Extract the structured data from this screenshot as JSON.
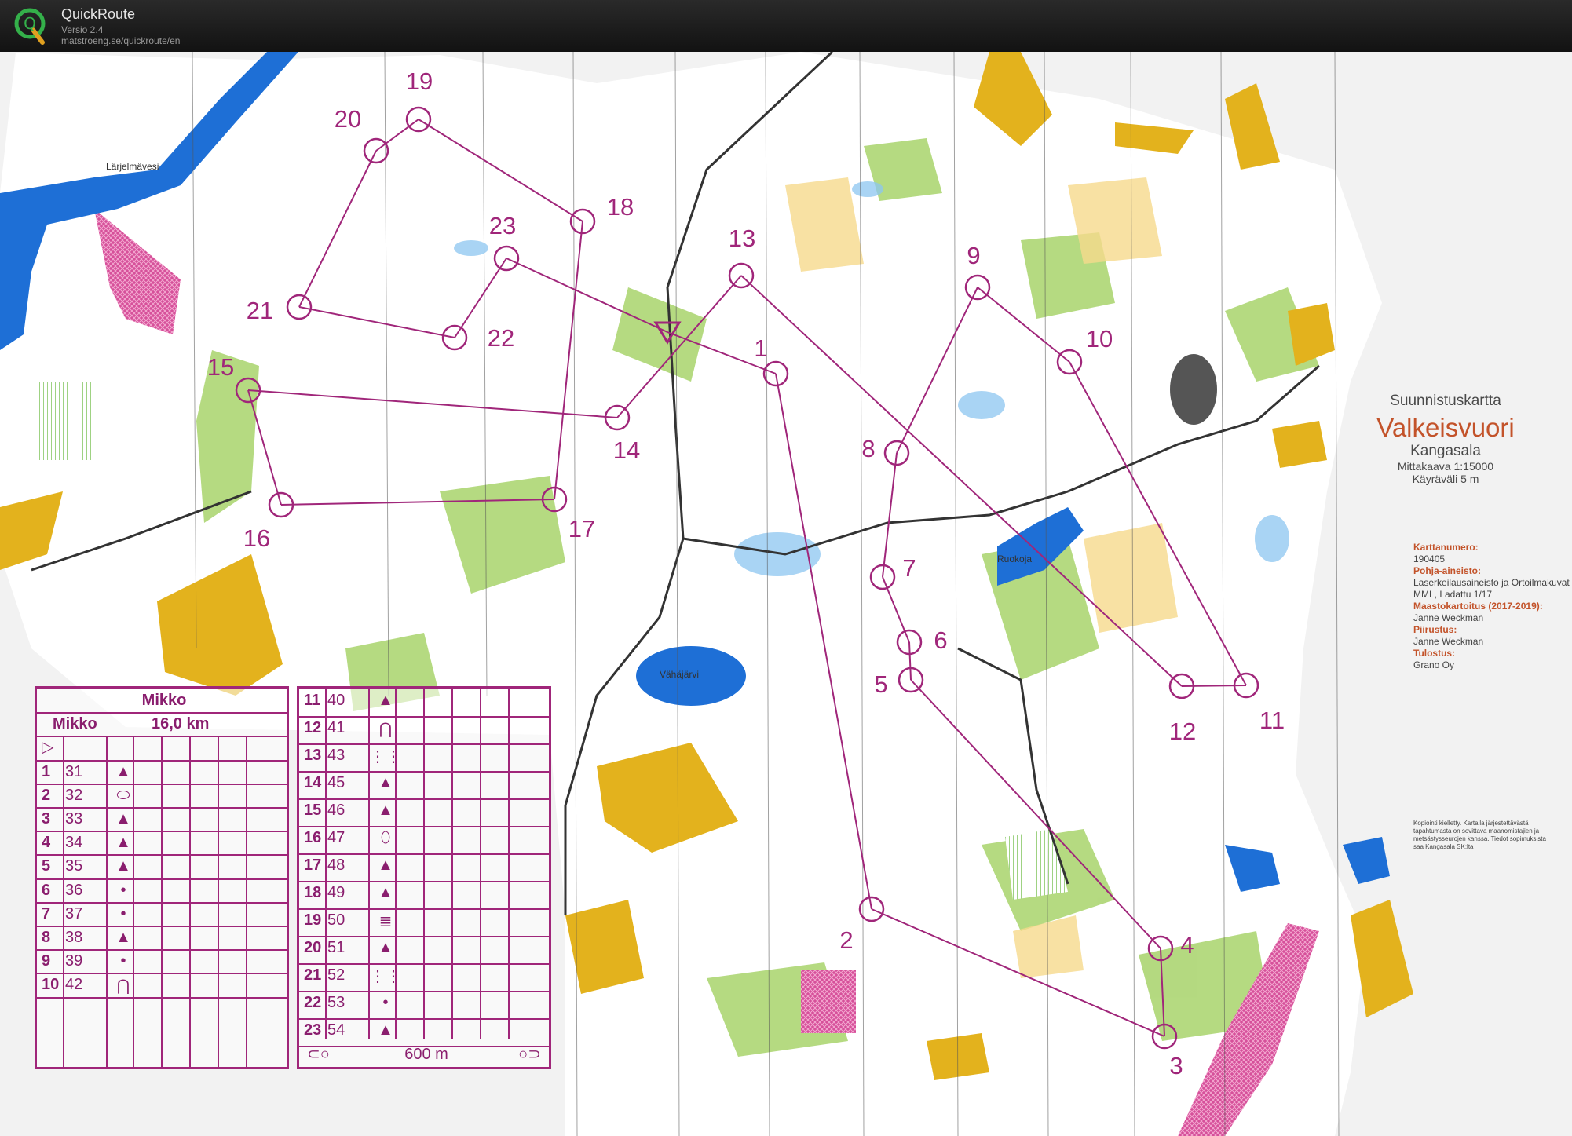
{
  "app": {
    "name": "QuickRoute",
    "version": "Versio 2.4",
    "url": "matstroeng.se/quickroute/en",
    "logo_letter": "Q"
  },
  "map": {
    "type": "Suunnistuskartta",
    "name": "Valkeisvuori",
    "place": "Kangasala",
    "scale": "Mittakaava 1:15000",
    "contour": "Käyräväli 5 m",
    "info": [
      {
        "label": "Karttanumero:",
        "value": "190405"
      },
      {
        "label": "Pohja-aineisto:",
        "value": "Laserkeilausaineisto ja Ortoilmakuvat MML, Ladattu 1/17"
      },
      {
        "label": "Maastokartoitus (2017-2019):",
        "value": "Janne Weckman"
      },
      {
        "label": "Piirustus:",
        "value": "Janne Weckman"
      },
      {
        "label": "Tulostus:",
        "value": "Grano Oy"
      }
    ],
    "copyright": "Kopiointi kielletty. Kartalla järjestettävästä tapahtumasta on sovittava maanomistajien ja metsästysseurojen kanssa. Tiedot sopimuksista saa Kangasala SK:lta",
    "lake_labels": [
      "Lärjelmävesi",
      "Vähäjärvi",
      "Ruokoja"
    ],
    "control_labels": [
      "1",
      "2",
      "3",
      "4",
      "5",
      "6",
      "7",
      "8",
      "9",
      "10",
      "11",
      "12",
      "13",
      "14",
      "15",
      "16",
      "17",
      "18",
      "19",
      "20",
      "21",
      "22",
      "23"
    ]
  },
  "description_sheet": {
    "title": "Mikko",
    "class": "Mikko",
    "length": "16,0 km",
    "marked_route": "600 m",
    "controls": [
      {
        "n": "1",
        "code": "31",
        "symbol": "▲"
      },
      {
        "n": "2",
        "code": "32",
        "symbol": "⬭"
      },
      {
        "n": "3",
        "code": "33",
        "symbol": "▲"
      },
      {
        "n": "4",
        "code": "34",
        "symbol": "▲"
      },
      {
        "n": "5",
        "code": "35",
        "symbol": "▲"
      },
      {
        "n": "6",
        "code": "36",
        "symbol": "•"
      },
      {
        "n": "7",
        "code": "37",
        "symbol": "•"
      },
      {
        "n": "8",
        "code": "38",
        "symbol": "▲"
      },
      {
        "n": "9",
        "code": "39",
        "symbol": "•"
      },
      {
        "n": "10",
        "code": "42",
        "symbol": "⋂"
      },
      {
        "n": "11",
        "code": "40",
        "symbol": "▲"
      },
      {
        "n": "12",
        "code": "41",
        "symbol": "⋂"
      },
      {
        "n": "13",
        "code": "43",
        "symbol": "⋮⋮"
      },
      {
        "n": "14",
        "code": "45",
        "symbol": "▲"
      },
      {
        "n": "15",
        "code": "46",
        "symbol": "▲"
      },
      {
        "n": "16",
        "code": "47",
        "symbol": "⬯"
      },
      {
        "n": "17",
        "code": "48",
        "symbol": "▲"
      },
      {
        "n": "18",
        "code": "49",
        "symbol": "▲"
      },
      {
        "n": "19",
        "code": "50",
        "symbol": "≣"
      },
      {
        "n": "20",
        "code": "51",
        "symbol": "▲"
      },
      {
        "n": "21",
        "code": "52",
        "symbol": "⋮⋮"
      },
      {
        "n": "22",
        "code": "53",
        "symbol": "•"
      },
      {
        "n": "23",
        "code": "54",
        "symbol": "▲"
      }
    ]
  },
  "colors": {
    "overprint": "#a0267a",
    "water": "#1e6fd6",
    "open_land": "#e8b820",
    "forest_green": "#9ccc5c"
  }
}
